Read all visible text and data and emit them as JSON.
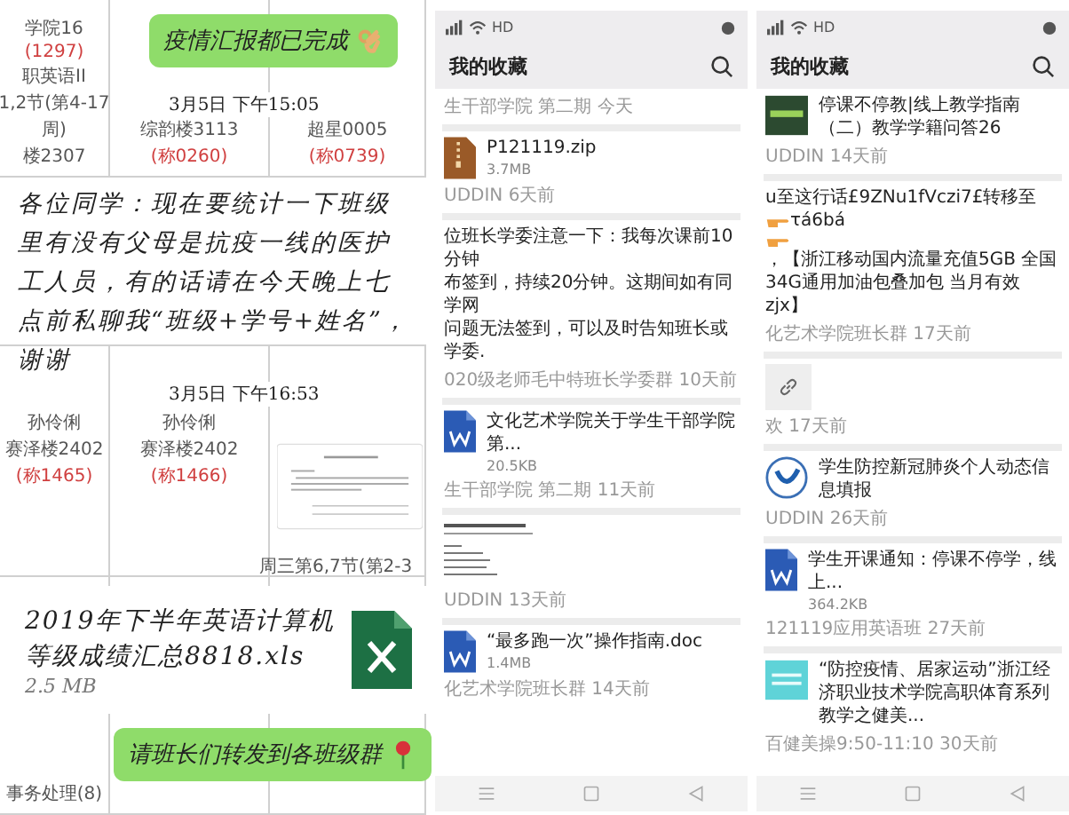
{
  "collage": {
    "table": {
      "rows": [
        {
          "cells": [
            [
              "学院16",
              "(1297)",
              "职英语II",
              "1,2节(第4-17",
              "周)",
              "楼2307"
            ],
            [
              "综韵楼3113",
              "(称0260)"
            ],
            [
              "超星0005",
              "(称0739)"
            ]
          ]
        },
        {
          "cells": [
            [],
            [],
            []
          ]
        },
        {
          "cells": [
            [
              "孙伶俐",
              "赛泽楼2402",
              "(称1465)"
            ],
            [
              "孙伶俐",
              "赛泽楼2402",
              "(称1466)"
            ],
            []
          ]
        },
        {
          "cells": [
            [
              "事务处理(8)"
            ],
            [],
            []
          ]
        }
      ]
    },
    "top_bubble": {
      "text": "疫情汇报都已完成"
    },
    "timestamps": [
      "3月5日 下午15:05",
      "3月5日 下午16:53"
    ],
    "notice_card": {
      "text": "各位同学：现在要统计一下班级里有没有父母是抗疫一线的医护工人员，有的话请在今天晚上七点前私聊我“班级+学号+姓名”，谢谢"
    },
    "table_note": "周三第6,7节(第2-3",
    "file_card": {
      "name": "2019年下半年英语计算机等级成绩汇总8818.xls",
      "size": "2.5 MB"
    },
    "bottom_bubble": {
      "text": "请班长们转发到各班级群"
    }
  },
  "phones": [
    {
      "status": "HD",
      "title": "我的收藏",
      "items": [
        {
          "kind": "meta",
          "meta": "生干部学院 第二期 今天"
        },
        {
          "kind": "zip",
          "name": "P121119.zip",
          "size": "3.7MB",
          "meta": "UDDIN 6天前"
        },
        {
          "kind": "text",
          "lines": [
            "位班长学委注意一下：我每次课前10分钟",
            "布签到，持续20分钟。这期间如有同学网",
            "问题无法签到，可以及时告知班长或学委."
          ],
          "meta": "020级老师毛中特班长学委群 10天前"
        },
        {
          "kind": "word",
          "name": "文化艺术学院关于学生干部学院第...",
          "size": "20.5KB",
          "meta": "生干部学院 第二期 11天前"
        },
        {
          "kind": "preview",
          "meta": "UDDIN 13天前"
        },
        {
          "kind": "word",
          "name": "“最多跑一次”操作指南.doc",
          "size": "1.4MB",
          "meta": "化艺术学院班长群 14天前"
        }
      ]
    },
    {
      "status": "HD",
      "title": "我的收藏",
      "items": [
        {
          "kind": "green-cover",
          "name": "停课不停教|线上教学指南（二）教学学籍问答26",
          "meta": "UDDIN 14天前"
        },
        {
          "kind": "segments",
          "lines": [
            [
              {
                "kind": "text",
                "text": "u至这行话£9ZNu1fVczi7£转移至"
              },
              {
                "kind": "emoji"
              },
              {
                "kind": "text",
                "text": "τá6bá"
              }
            ],
            [
              {
                "kind": "emoji"
              },
              {
                "kind": "text",
                "text": "，【浙江移动国内流量充值5GB 全国"
              }
            ],
            [
              {
                "kind": "text",
                "text": "34G通用加油包叠加包 当月有效zjx】"
              }
            ]
          ],
          "meta": "化艺术学院班长群 17天前"
        },
        {
          "kind": "link",
          "meta": "欢 17天前"
        },
        {
          "kind": "seal",
          "name": "学生防控新冠肺炎个人动态信息填报",
          "meta": "UDDIN 26天前"
        },
        {
          "kind": "word",
          "name": "学生开课通知：停课不停学，线上...",
          "size": "364.2KB",
          "meta": "121119应用英语班 27天前"
        },
        {
          "kind": "cyan-cover",
          "name": "“防控疫情、居家运动”浙江经济职业技术学院高职体育系列教学之健美...",
          "meta": "百健美操9:50-11:10 30天前"
        }
      ]
    }
  ]
}
